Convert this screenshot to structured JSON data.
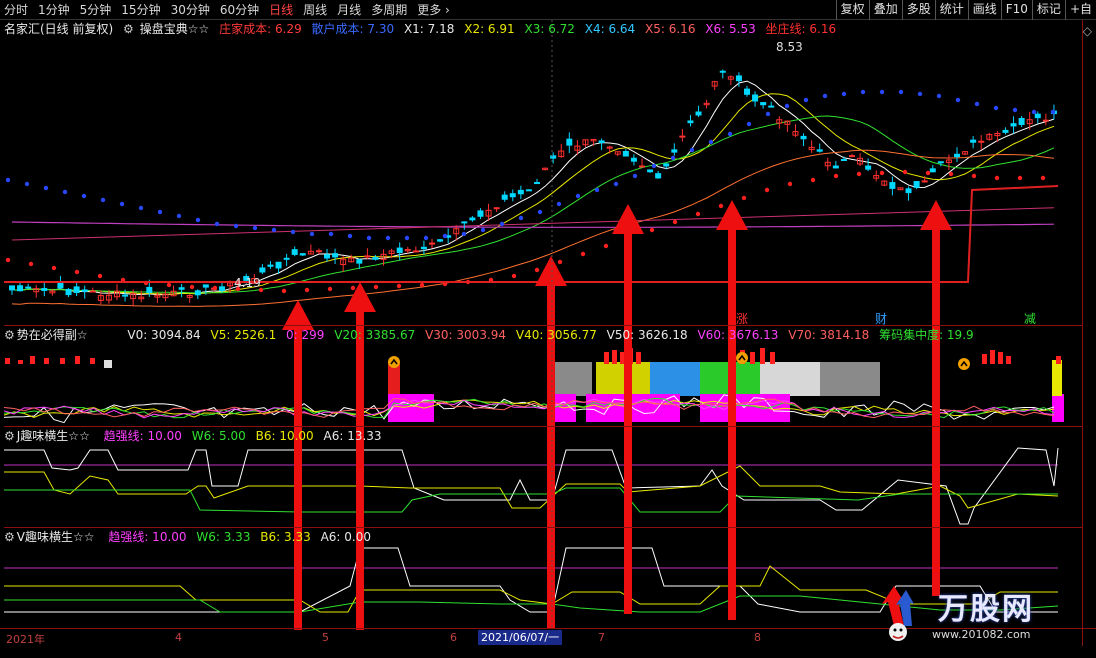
{
  "toolbar": {
    "periods": [
      "分时",
      "1分钟",
      "5分钟",
      "15分钟",
      "30分钟",
      "60分钟",
      "日线",
      "周线",
      "月线",
      "多周期",
      "更多"
    ],
    "active_period": "日线",
    "tools": [
      "复权",
      "叠加",
      "多股",
      "统计",
      "画线",
      "F10",
      "标记",
      "+自"
    ]
  },
  "infobar": {
    "stock": "名家汇(日线 前复权)",
    "indicator": "操盘宝典☆☆",
    "zhuang": "庄家成本: 6.29",
    "sanhu": "散户成本: 7.30",
    "x1": "X1: 7.18",
    "x2": "X2: 6.91",
    "x3": "X3: 6.72",
    "x4": "X4: 6.64",
    "x5": "X5: 6.16",
    "x6": "X6: 5.53",
    "zuozhuang": "坐庄线: 6.16"
  },
  "main_chart": {
    "high_label": "8.53",
    "low_label": "4.19",
    "markers": [
      "涨",
      "财",
      "减"
    ]
  },
  "panel2": {
    "title": "势在必得副☆",
    "v0": "V0: 3094.84",
    "v5": "V5: 2526.1",
    "v10": "0: 299",
    "v20": "V20: 3385.67",
    "v30": "V30: 3003.94",
    "v40": "V40: 3056.77",
    "v50": "V50: 3626.18",
    "v60": "V60: 3676.13",
    "v70": "V70: 3814.18",
    "chouma": "筹码集中度: 19.9"
  },
  "panel3": {
    "title": "J趣味横生☆☆",
    "qiang": "趋强线: 10.00",
    "w6": "W6: 5.00",
    "b6": "B6: 10.00",
    "a6": "A6: 13.33"
  },
  "panel4": {
    "title": "V趣味横生☆☆",
    "qiang": "趋强线: 10.00",
    "w6": "W6: 3.33",
    "b6": "B6: 3.33",
    "a6": "A6: 0.00"
  },
  "xaxis": {
    "ticks": [
      "2021年",
      "4",
      "5",
      "6",
      "7",
      "8"
    ],
    "cursor_date": "2021/06/07/一"
  },
  "watermark": {
    "title": "万股网",
    "url": "www.201082.com"
  },
  "colors": {
    "up": "#ff3030",
    "down": "#00d8ff",
    "arrow": "#ee1010",
    "divider": "#8b1010"
  }
}
